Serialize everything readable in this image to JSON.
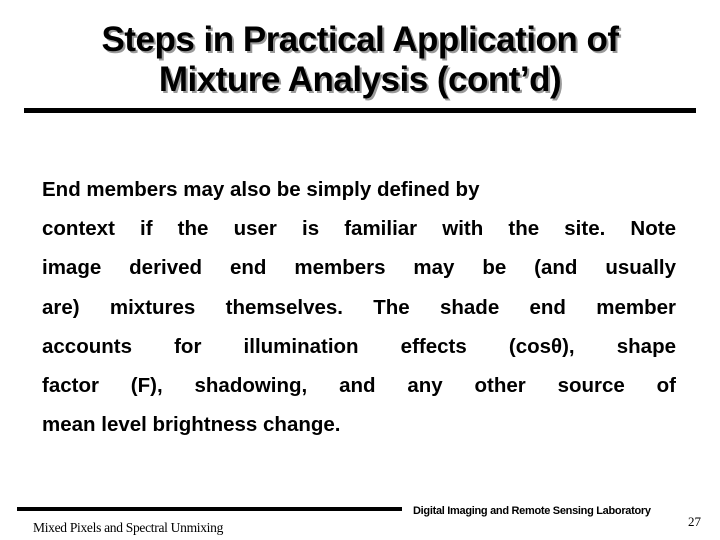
{
  "slide": {
    "title_line1": "Steps in Practical Application of",
    "title_line2": "Mixture Analysis (cont’d)",
    "body_lines": [
      "End members may also be simply defined by",
      "context if the user is familiar with the site.  Note",
      "image derived end members may be (and usually",
      "are) mixtures themselves.  The shade end member",
      "accounts for illumination effects (cosθ), shape",
      "factor (F), shadowing, and any other source of",
      "mean level brightness change."
    ]
  },
  "footer": {
    "lab_name": "Digital Imaging and Remote Sensing Laboratory",
    "page_number": "27",
    "course_title": "Mixed Pixels and Spectral Unmixing"
  }
}
